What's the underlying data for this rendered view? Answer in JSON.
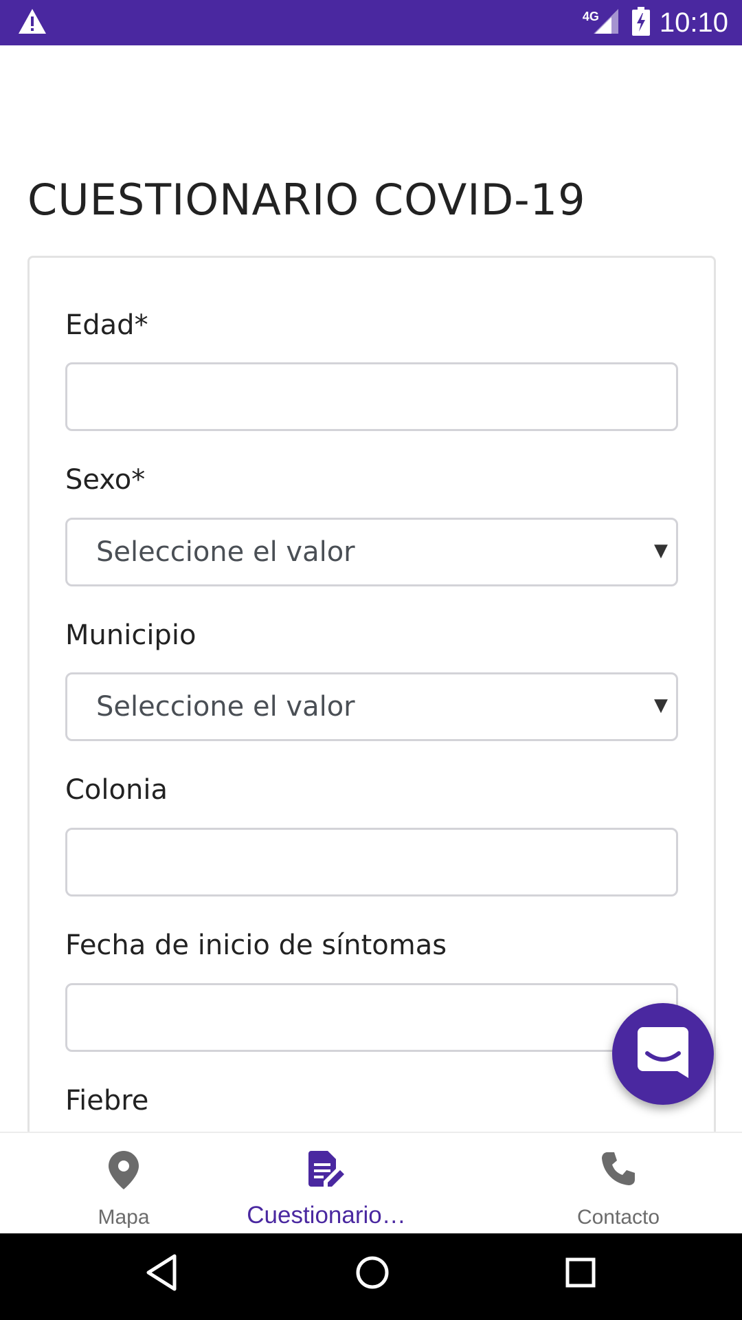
{
  "status_bar": {
    "time": "10:10",
    "network": "4G",
    "icons": [
      "warning-icon",
      "signal-icon",
      "battery-charging-icon"
    ],
    "background_color": "#4a28a0"
  },
  "page": {
    "title": "CUESTIONARIO COVID-19"
  },
  "form": {
    "fields": [
      {
        "label": "Edad*",
        "type": "text",
        "value": ""
      },
      {
        "label": "Sexo*",
        "type": "select",
        "value": "Seleccione el valor"
      },
      {
        "label": "Municipio",
        "type": "select",
        "value": "Seleccione el valor"
      },
      {
        "label": "Colonia",
        "type": "text",
        "value": ""
      },
      {
        "label": "Fecha de inicio de síntomas",
        "type": "text",
        "value": ""
      },
      {
        "label": "Fiebre",
        "type": "text",
        "value": ""
      }
    ]
  },
  "chat_fab": {
    "icon": "chat-icon",
    "color": "#4a28a0"
  },
  "bottom_nav": {
    "items": [
      {
        "label": "Mapa",
        "icon": "map-pin-icon",
        "active": false
      },
      {
        "label": "Cuestionario…",
        "icon": "edit-document-icon",
        "active": true
      },
      {
        "label": "Contacto",
        "icon": "phone-icon",
        "active": false
      }
    ],
    "active_color": "#4a28a0",
    "inactive_color": "#6b6b6b"
  },
  "system_nav": {
    "icons": [
      "back-icon",
      "home-icon",
      "recents-icon"
    ]
  }
}
